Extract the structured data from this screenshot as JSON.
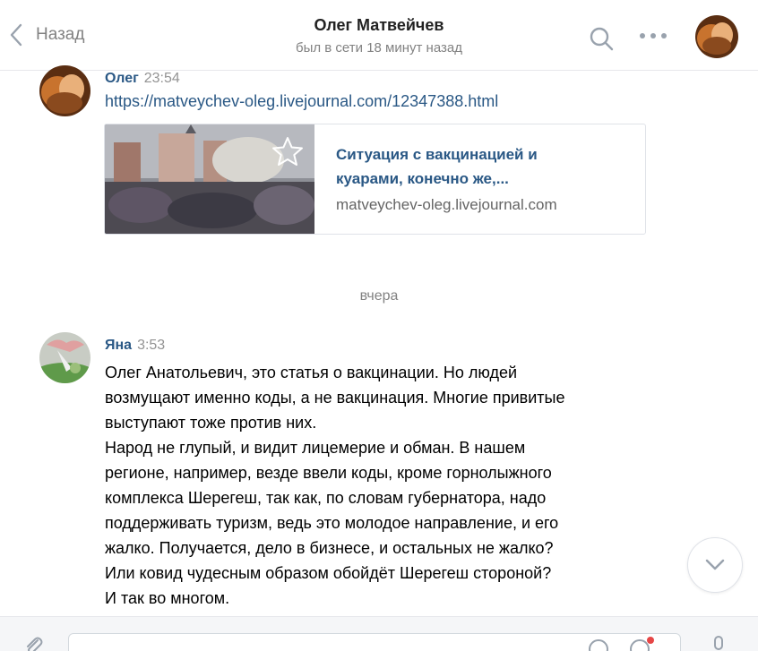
{
  "header": {
    "back_label": "Назад",
    "title": "Олег Матвейчев",
    "subtitle": "был в сети 18 минут назад",
    "icons": [
      "chevron-left-icon",
      "search-icon",
      "more-icon",
      "avatar"
    ]
  },
  "messages": [
    {
      "author": "Олег",
      "time": "23:54",
      "link": "https://matveychev-oleg.livejournal.com/12347388.html",
      "card": {
        "title_line1": "Ситуация с вакцинацией и",
        "title_line2": "куарами, конечно же,...",
        "domain": "matveychev-oleg.livejournal.com"
      }
    },
    {
      "author": "Яна",
      "time": "3:53",
      "lines": [
        "Олег Анатольевич, это статья о вакцинации. Но людей",
        "возмущают именно коды, а не вакцинация. Многие привитые",
        "выступают тоже против них.",
        "Народ не глупый, и видит лицемерие и обман. В нашем",
        "регионе, например, везде ввели коды, кроме горнолыжного",
        "комплекса Шерегеш, так как, по словам губернатора, надо",
        "поддерживать туризм, ведь это молодое направление, и его",
        "жалко. Получается, дело в бизнесе, и остальных не жалко?",
        "Или ковид чудесным образом обойдёт Шерегеш стороной?",
        "И так во многом."
      ]
    }
  ],
  "date_separator": "вчера",
  "colors": {
    "link": "#2a5885",
    "muted": "#828282",
    "border": "#e7e8ec",
    "composer_bg": "#f5f6f8"
  }
}
